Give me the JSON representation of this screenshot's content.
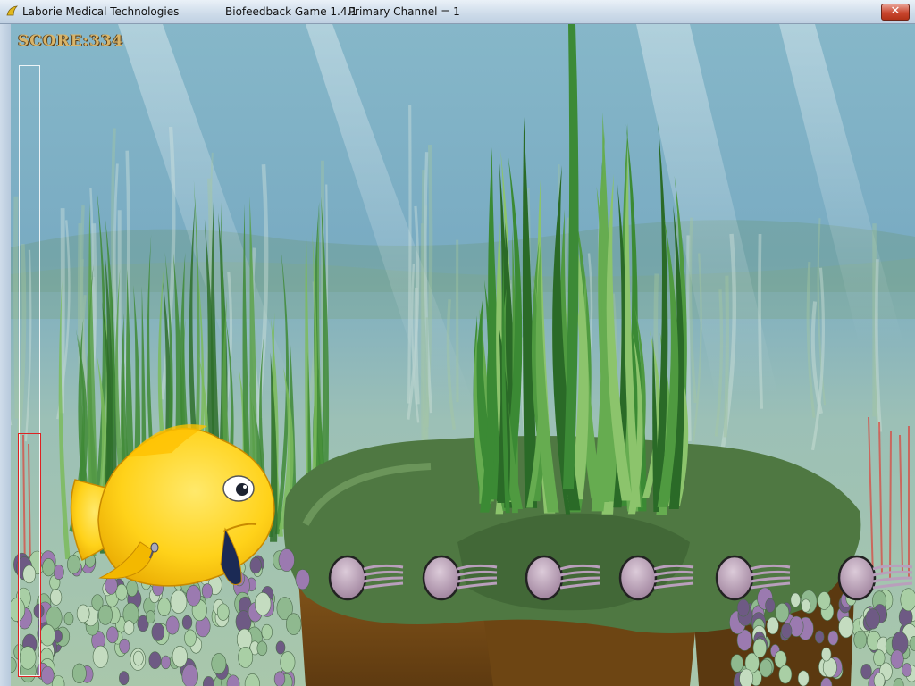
{
  "window": {
    "app_name": "Laborie Medical Technologies",
    "game_title": "Biofeedback Game 1.4.1",
    "channel_info": "Primary Channel = 1",
    "close_label": "✕"
  },
  "hud": {
    "score_text": "SCORE:334",
    "meter_level_fraction": 0.0,
    "target_zone_from": 0.0,
    "target_zone_to": 0.4
  },
  "scene": {
    "player": "yellow-fish",
    "obstacles": [
      "jellyfish",
      "jellyfish",
      "jellyfish",
      "jellyfish",
      "jellyfish",
      "jellyfish"
    ],
    "colors": {
      "water": "#6fa3bd",
      "fish": "#ffd21a",
      "jellyfish": "#b89cb6",
      "target_zone": "#dd2222"
    }
  }
}
